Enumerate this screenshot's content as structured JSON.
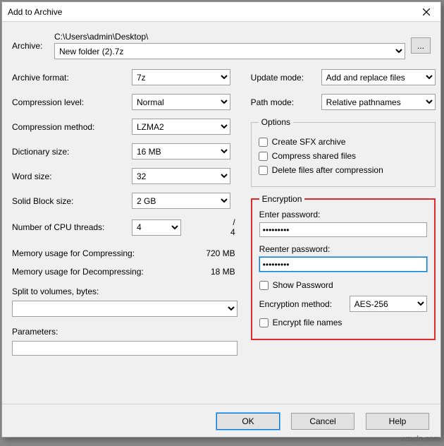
{
  "window": {
    "title": "Add to Archive"
  },
  "archive": {
    "label": "Archive:",
    "path": "C:\\Users\\admin\\Desktop\\",
    "filename": "New folder (2).7z",
    "browse": "..."
  },
  "left": {
    "archive_format": {
      "label": "Archive format:",
      "value": "7z"
    },
    "compression_level": {
      "label": "Compression level:",
      "value": "Normal"
    },
    "compression_method": {
      "label": "Compression method:",
      "value": "LZMA2"
    },
    "dictionary_size": {
      "label": "Dictionary size:",
      "value": "16 MB"
    },
    "word_size": {
      "label": "Word size:",
      "value": "32"
    },
    "solid_block_size": {
      "label": "Solid Block size:",
      "value": "2 GB"
    },
    "cpu_threads": {
      "label": "Number of CPU threads:",
      "value": "4",
      "total": "/ 4"
    },
    "mem_compress": {
      "label": "Memory usage for Compressing:",
      "value": "720 MB"
    },
    "mem_decompress": {
      "label": "Memory usage for Decompressing:",
      "value": "18 MB"
    },
    "split": {
      "label": "Split to volumes, bytes:",
      "value": ""
    },
    "parameters": {
      "label": "Parameters:",
      "value": ""
    }
  },
  "right": {
    "update_mode": {
      "label": "Update mode:",
      "value": "Add and replace files"
    },
    "path_mode": {
      "label": "Path mode:",
      "value": "Relative pathnames"
    },
    "options": {
      "legend": "Options",
      "sfx": "Create SFX archive",
      "shared": "Compress shared files",
      "delete_after": "Delete files after compression"
    },
    "encryption": {
      "legend": "Encryption",
      "enter": "Enter password:",
      "reenter": "Reenter password:",
      "password": "•••••••••",
      "show": "Show Password",
      "method_label": "Encryption method:",
      "method_value": "AES-256",
      "encrypt_names": "Encrypt file names"
    }
  },
  "buttons": {
    "ok": "OK",
    "cancel": "Cancel",
    "help": "Help"
  },
  "watermark": "wsxdn.com"
}
